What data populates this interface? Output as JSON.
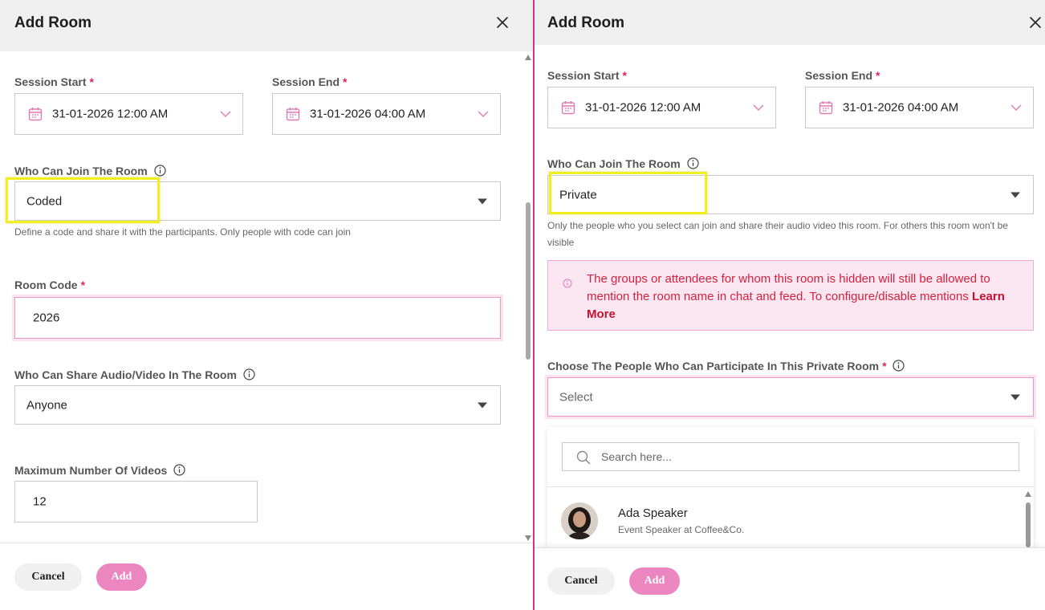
{
  "left": {
    "title": "Add Room",
    "session_start": {
      "label": "Session Start",
      "value": "31-01-2026 12:00 AM"
    },
    "session_end": {
      "label": "Session End",
      "value": "31-01-2026 04:00 AM"
    },
    "who_can_join": {
      "label": "Who Can Join The Room",
      "value": "Coded",
      "hint": "Define a code and share it with the participants. Only people with code can join"
    },
    "room_code": {
      "label": "Room Code",
      "value": "2026"
    },
    "who_can_share": {
      "label": "Who Can Share Audio/Video In The Room",
      "value": "Anyone"
    },
    "max_videos": {
      "label": "Maximum Number Of Videos",
      "value": "12"
    },
    "cancel_label": "Cancel",
    "add_label": "Add"
  },
  "right": {
    "title": "Add Room",
    "session_start": {
      "label": "Session Start",
      "value": "31-01-2026 12:00 AM"
    },
    "session_end": {
      "label": "Session End",
      "value": "31-01-2026 04:00 AM"
    },
    "who_can_join": {
      "label": "Who Can Join The Room",
      "value": "Private",
      "hint": "Only the people who you select can join and share their audio video this room. For others this room won't be visible"
    },
    "alert": {
      "text": "The groups or attendees for whom this room is hidden will still be allowed to mention the room name in chat and feed. To configure/disable mentions",
      "link": "Learn More"
    },
    "choose_people": {
      "label": "Choose The People Who Can Participate In This Private Room",
      "placeholder": "Select"
    },
    "search": {
      "placeholder": "Search here..."
    },
    "people": [
      {
        "name": "Ada Speaker",
        "title": "Event Speaker at Coffee&Co."
      }
    ],
    "cancel_label": "Cancel",
    "add_label": "Add"
  },
  "colors": {
    "accent": "#ec86c1",
    "required": "#e0245e",
    "highlight": "#f0f021",
    "alert_bg": "#fce6f1",
    "alert_text": "#d1233f"
  }
}
